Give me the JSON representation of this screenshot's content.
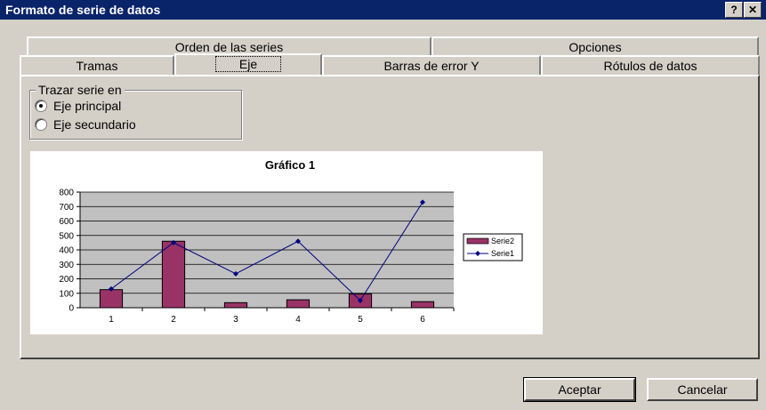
{
  "dialog": {
    "title": "Formato de serie de datos",
    "help_button": "?",
    "close_button": "✕"
  },
  "tabs": {
    "back_row": [
      "Orden de las series",
      "Opciones"
    ],
    "front_row": [
      "Tramas",
      "Eje",
      "Barras de error Y",
      "Rótulos de datos"
    ],
    "active": "Eje"
  },
  "axis_group": {
    "legend": "Trazar serie en",
    "options": [
      {
        "label": "Eje principal",
        "selected": true
      },
      {
        "label": "Eje secundario",
        "selected": false
      }
    ]
  },
  "chart_data": {
    "type": "bar",
    "title": "Gráfico 1",
    "categories": [
      "1",
      "2",
      "3",
      "4",
      "5",
      "6"
    ],
    "series": [
      {
        "name": "Serie2",
        "kind": "bar",
        "color": "#993366",
        "values": [
          125,
          460,
          35,
          55,
          95,
          42
        ]
      },
      {
        "name": "Serie1",
        "kind": "line",
        "color": "#000080",
        "values": [
          130,
          450,
          235,
          460,
          50,
          730
        ]
      }
    ],
    "ylim": [
      0,
      800
    ],
    "y_ticks": [
      "0",
      "100",
      "200",
      "300",
      "400",
      "500",
      "600",
      "700",
      "800"
    ],
    "grid": true,
    "plot_background": "#c0c0c0",
    "legend_position": "right"
  },
  "buttons": {
    "accept": "Aceptar",
    "cancel": "Cancelar"
  }
}
